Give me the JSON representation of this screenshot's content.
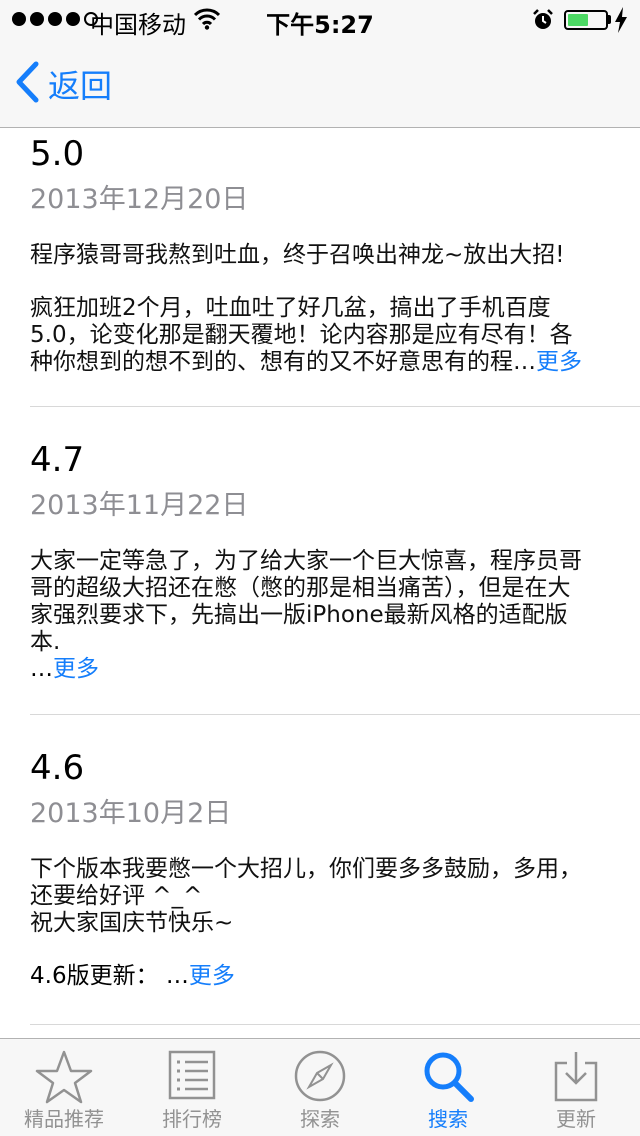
{
  "status_bar": {
    "carrier": "中国移动",
    "time": "下午5:27",
    "signal_bars_filled": 4,
    "signal_bars_total": 5,
    "battery_level": 0.55,
    "battery_color": "#4cd964"
  },
  "nav": {
    "back_label": "返回",
    "back_icon": "chevron-left-icon"
  },
  "accent_color": "#157efb",
  "entries": [
    {
      "version": "5.0",
      "date": "2013年12月20日",
      "paragraphs": [
        "程序猿哥哥我熬到吐血，终于召唤出神龙~放出大招!",
        "疯狂加班2个月，吐血吐了好几盆，搞出了手机百度\n5.0，论变化那是翻天覆地！论内容那是应有尽有！各\n种你想到的想不到的、想有的又不好意思有的程…"
      ],
      "more_prefix": "",
      "more": "更多"
    },
    {
      "version": "4.7",
      "date": "2013年11月22日",
      "paragraphs": [
        "大家一定等急了，为了给大家一个巨大惊喜，程序员哥\n哥的超级大招还在憋（憋的那是相当痛苦），但是在大\n家强烈要求下，先搞出一版iPhone最新风格的适配版\n本."
      ],
      "more_prefix": " …",
      "more": "更多"
    },
    {
      "version": "4.6",
      "date": "2013年10月2日",
      "paragraphs": [
        "下个版本我要憋一个大招儿，你们要多多鼓励，多用，\n还要给好评 ^_^\n祝大家国庆节快乐~"
      ],
      "more_prefix": "4.6版更新： …",
      "more": "更多"
    }
  ],
  "tabs": [
    {
      "label": "精品推荐",
      "icon": "star-icon",
      "active": false
    },
    {
      "label": "排行榜",
      "icon": "list-icon",
      "active": false
    },
    {
      "label": "探索",
      "icon": "compass-icon",
      "active": false
    },
    {
      "label": "搜索",
      "icon": "search-icon",
      "active": true
    },
    {
      "label": "更新",
      "icon": "download-icon",
      "active": false
    }
  ]
}
